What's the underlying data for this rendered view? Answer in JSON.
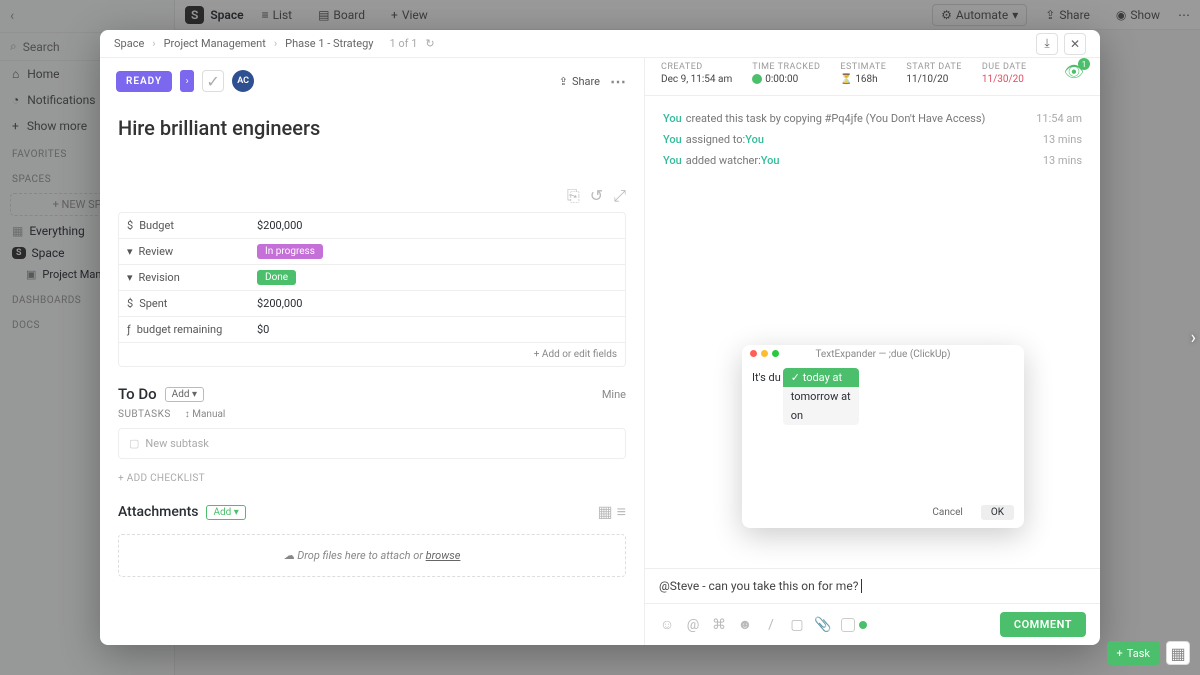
{
  "workspace": "Space",
  "search_placeholder": "Search",
  "nav": {
    "home": "Home",
    "notifications": "Notifications",
    "show_more": "Show more"
  },
  "sections": {
    "favorites": "FAVORITES",
    "spaces": "SPACES",
    "dashboards": "DASHBOARDS",
    "docs": "DOCS"
  },
  "new_space": "+  NEW SPACE",
  "tree": {
    "everything": "Everything",
    "space": "Space",
    "project": "Project Management"
  },
  "topbar": {
    "list": "List",
    "board": "Board",
    "view": "View",
    "automate": "Automate",
    "share": "Share",
    "show": "Show"
  },
  "breadcrumbs": [
    "Space",
    "Project Management",
    "Phase 1 - Strategy"
  ],
  "page_indicator": "1 of 1",
  "status": "READY",
  "avatar_initials": "AC",
  "share_label": "Share",
  "meta": {
    "created_label": "CREATED",
    "created_value": "Dec 9, 11:54 am",
    "tracked_label": "TIME TRACKED",
    "tracked_value": "0:00:00",
    "estimate_label": "ESTIMATE",
    "estimate_value": "168h",
    "start_label": "START DATE",
    "start_value": "11/10/20",
    "due_label": "DUE DATE",
    "due_value": "11/30/20",
    "watchers": "1"
  },
  "task_title": "Hire brilliant engineers",
  "fields": {
    "budget_k": "Budget",
    "budget_v": "$200,000",
    "review_k": "Review",
    "review_v": "In progress",
    "revision_k": "Revision",
    "revision_v": "Done",
    "spent_k": "Spent",
    "spent_v": "$200,000",
    "remain_k": "budget remaining",
    "remain_v": "$0",
    "add": "+ Add or edit fields"
  },
  "todo": {
    "title": "To Do",
    "add": "Add",
    "mine": "Mine"
  },
  "subtasks": {
    "label": "SUBTASKS",
    "manual": "Manual",
    "placeholder": "New subtask"
  },
  "add_checklist": "+ ADD CHECKLIST",
  "attachments": {
    "title": "Attachments",
    "add": "Add",
    "drop": "Drop files here to attach or ",
    "browse": "browse"
  },
  "activity": [
    {
      "who": "You",
      "text": " created this task by copying #Pq4jfe (You Don't Have Access)",
      "time": "11:54 am"
    },
    {
      "who": "You",
      "text": " assigned to: ",
      "who2": "You",
      "time": "13 mins"
    },
    {
      "who": "You",
      "text": " added watcher: ",
      "who2": "You",
      "time": "13 mins"
    }
  ],
  "comment_text": "@Steve - can you take this on for me? ",
  "comment_button": "COMMENT",
  "te": {
    "title": "TextExpander — ;due (ClickUp)",
    "prefix": "It's du",
    "options": [
      "today at",
      "tomorrow at",
      "on"
    ],
    "cancel": "Cancel",
    "ok": "OK"
  },
  "task_button": "Task"
}
